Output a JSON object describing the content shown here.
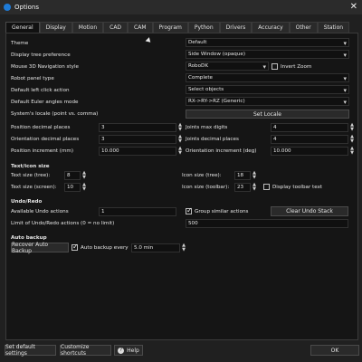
{
  "window": {
    "title": "Options",
    "close_glyph": "✕"
  },
  "tabs": [
    "General",
    "Display",
    "Motion",
    "CAD",
    "CAM",
    "Program",
    "Python",
    "Drivers",
    "Accuracy",
    "Other",
    "Station"
  ],
  "general": {
    "theme": {
      "label": "Theme",
      "value": "Default"
    },
    "display_tree": {
      "label": "Display tree preference",
      "value": "Side Window (opaque)"
    },
    "mouse_nav": {
      "label": "Mouse 3D Navigation style",
      "value": "RoboDK",
      "invert_label": "Invert Zoom"
    },
    "robot_panel": {
      "label": "Robot panel type",
      "value": "Complete"
    },
    "left_click": {
      "label": "Default left click action",
      "value": "Select objects"
    },
    "euler_mode": {
      "label": "Default Euler angles mode",
      "value": "RX->RY->RZ (Generic)"
    },
    "locale": {
      "label": "System's locale (point vs. comma)",
      "button": "Set Locale"
    },
    "pos_decimals": {
      "label": "Position decimal places",
      "value": "3"
    },
    "joints_digits": {
      "label": "Joints max digits",
      "value": "4"
    },
    "orient_decimals": {
      "label": "Orientation decimal places",
      "value": "3"
    },
    "joints_decimals": {
      "label": "Joints decimal places",
      "value": "4"
    },
    "pos_increment": {
      "label": "Position increment (mm)",
      "value": "10.000"
    },
    "orient_increment": {
      "label": "Orientation increment (deg)",
      "value": "10.000"
    }
  },
  "text_icon": {
    "heading": "Text/icon size",
    "text_tree": {
      "label": "Text size (tree):",
      "value": "8"
    },
    "text_screen": {
      "label": "Text size (screen):",
      "value": "10"
    },
    "icon_tree": {
      "label": "Icon size (tree):",
      "value": "18"
    },
    "icon_toolbar": {
      "label": "Icon size (toolbar):",
      "value": "23"
    },
    "display_toolbar_text": "Display toolbar text"
  },
  "undo": {
    "heading": "Undo/Redo",
    "available_label": "Available Undo actions",
    "available_value": "1",
    "group_label": "Group similar actions",
    "clear_button": "Clear Undo Stack",
    "limit_label": "Limit of Undo/Redo actions (0 = no limit)",
    "limit_value": "500"
  },
  "auto_backup": {
    "heading": "Auto backup",
    "recover_button": "Recover Auto Backup",
    "every_label": "Auto backup every",
    "every_value": "5.0 min"
  },
  "bottom": {
    "set_defaults": "Set default settings",
    "customize": "Customize shortcuts",
    "help": "Help",
    "ok": "OK"
  }
}
